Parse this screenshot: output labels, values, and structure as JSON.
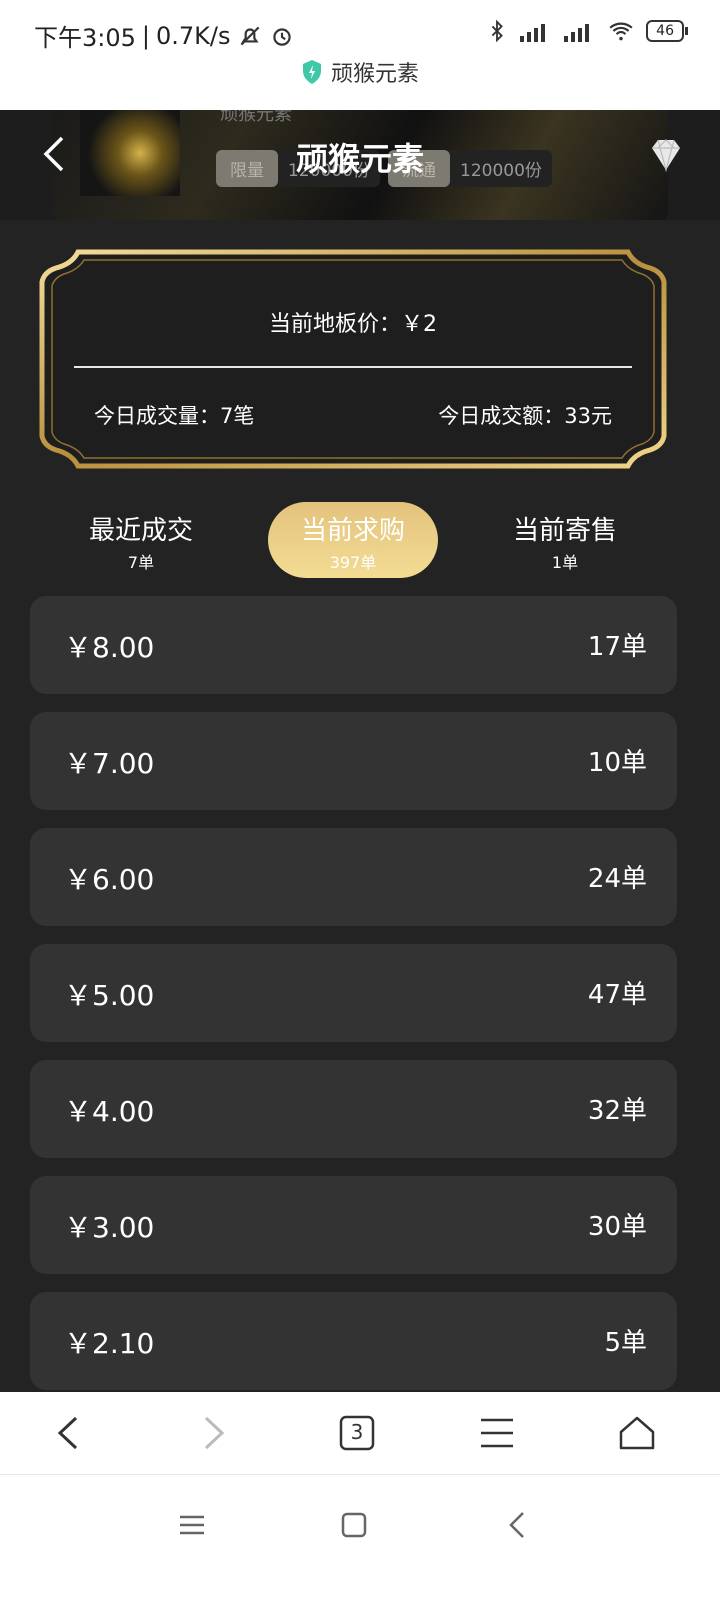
{
  "status_bar": {
    "time": "下午3:05",
    "speed": "0.7K/s",
    "battery": "46",
    "app_name": "顽猴元素"
  },
  "header": {
    "title": "顽猴元素",
    "ghost_title": "顽猴元素",
    "tag1_label": "限量",
    "tag1_value": "120000份",
    "tag2_label": "流通",
    "tag2_value": "120000份"
  },
  "summary": {
    "floor_price": "当前地板价：￥2",
    "today_volume": "今日成交量：7笔",
    "today_amount": "今日成交额：33元"
  },
  "tabs": [
    {
      "label": "最近成交",
      "count": "7单"
    },
    {
      "label": "当前求购",
      "count": "397单"
    },
    {
      "label": "当前寄售",
      "count": "1单"
    }
  ],
  "orders": [
    {
      "price": "￥8.00",
      "count": "17单"
    },
    {
      "price": "￥7.00",
      "count": "10单"
    },
    {
      "price": "￥6.00",
      "count": "24单"
    },
    {
      "price": "￥5.00",
      "count": "47单"
    },
    {
      "price": "￥4.00",
      "count": "32单"
    },
    {
      "price": "￥3.00",
      "count": "30单"
    },
    {
      "price": "￥2.10",
      "count": "5单"
    }
  ],
  "browser_bar": {
    "tab_count": "3"
  },
  "colors": {
    "background": "#232323",
    "row": "#333333",
    "gold": "#e3c27c",
    "shield": "#3ec8a8"
  }
}
